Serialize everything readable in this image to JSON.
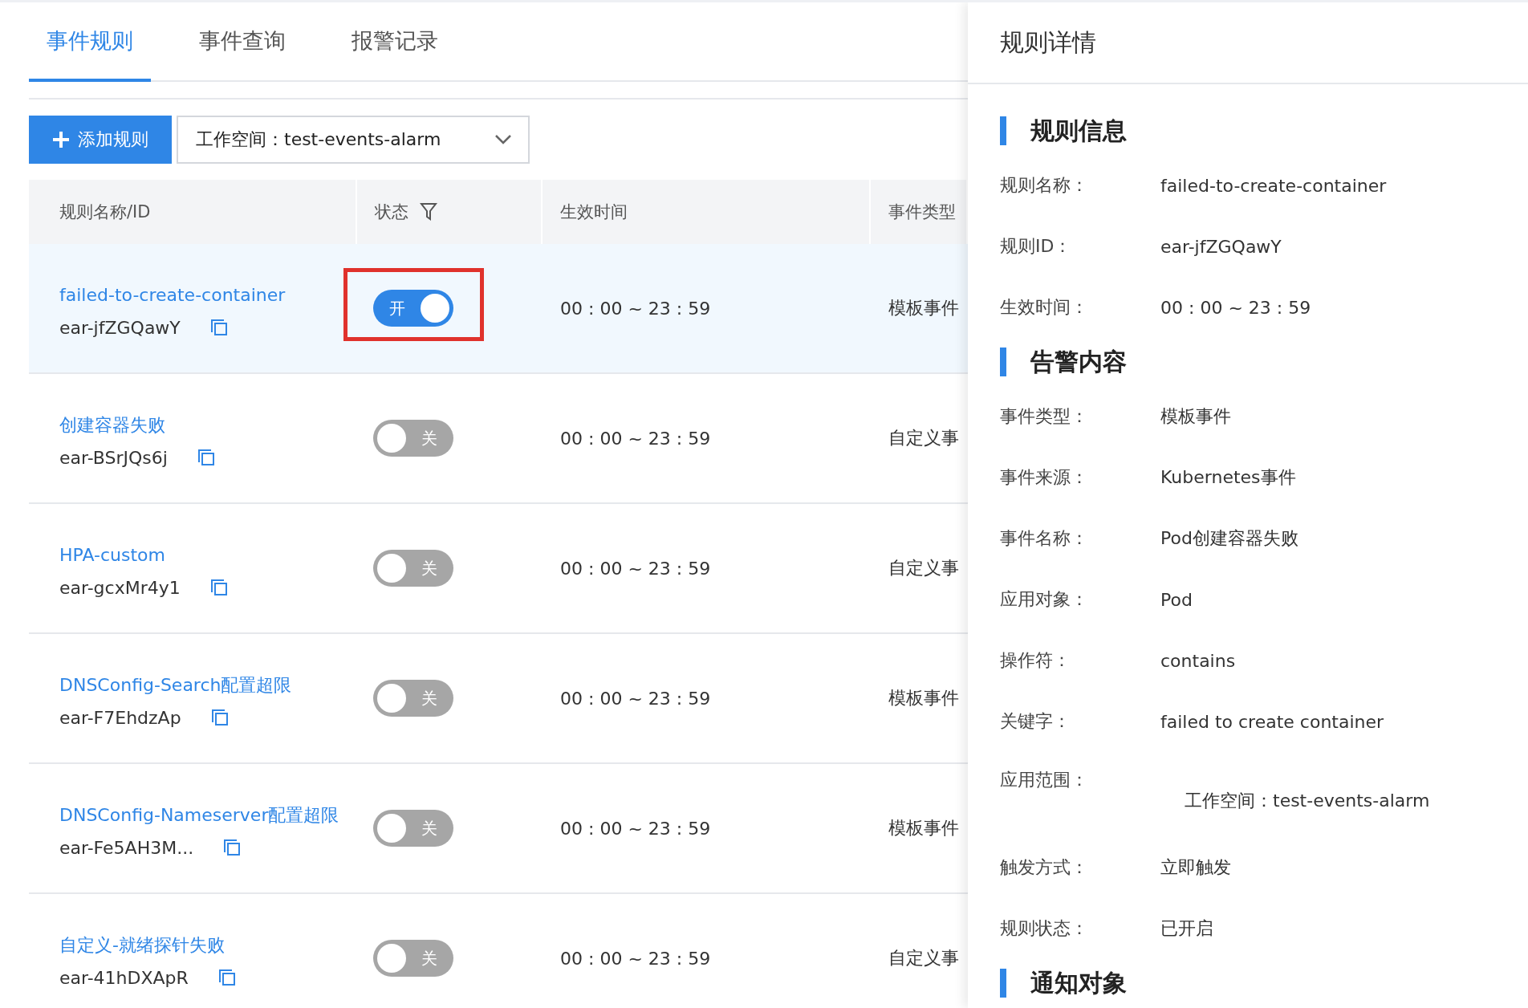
{
  "tabs": [
    {
      "label": "事件规则",
      "selected": true
    },
    {
      "label": "事件查询",
      "selected": false
    },
    {
      "label": "报警记录",
      "selected": false
    }
  ],
  "toolbar": {
    "add_button": "添加规则",
    "workspace_select": "工作空间：test-events-alarm"
  },
  "table": {
    "columns": [
      {
        "label": "规则名称/ID",
        "filter": false
      },
      {
        "label": "状态",
        "filter": true
      },
      {
        "label": "生效时间",
        "filter": false
      },
      {
        "label": "事件类型",
        "filter": false
      }
    ],
    "rows": [
      {
        "name": "failed-to-create-container",
        "id": "ear-jfZGQawY",
        "on": true,
        "switch_label": "开",
        "time": "00 : 00 ~ 23 : 59",
        "event_type": "模板事件",
        "selected": true,
        "highlighted": true
      },
      {
        "name": "创建容器失败",
        "id": "ear-BSrJQs6j",
        "on": false,
        "switch_label": "关",
        "time": "00 : 00 ~ 23 : 59",
        "event_type": "自定义事",
        "selected": false,
        "highlighted": false
      },
      {
        "name": "HPA-custom",
        "id": "ear-gcxMr4y1",
        "on": false,
        "switch_label": "关",
        "time": "00 : 00 ~ 23 : 59",
        "event_type": "自定义事",
        "selected": false,
        "highlighted": false
      },
      {
        "name": "DNSConfig-Search配置超限",
        "id": "ear-F7EhdzAp",
        "on": false,
        "switch_label": "关",
        "time": "00 : 00 ~ 23 : 59",
        "event_type": "模板事件",
        "selected": false,
        "highlighted": false
      },
      {
        "name": "DNSConfig-Nameserver配置超限",
        "id": "ear-Fe5AH3M...",
        "on": false,
        "switch_label": "关",
        "time": "00 : 00 ~ 23 : 59",
        "event_type": "模板事件",
        "selected": false,
        "highlighted": false
      },
      {
        "name": "自定义-就绪探针失败",
        "id": "ear-41hDXApR",
        "on": false,
        "switch_label": "关",
        "time": "00 : 00 ~ 23 : 59",
        "event_type": "自定义事",
        "selected": false,
        "highlighted": false
      }
    ]
  },
  "detail_panel": {
    "title": "规则详情",
    "sections": [
      {
        "title": "规则信息",
        "fields": [
          {
            "label": "规则名称：",
            "value": "failed-to-create-container",
            "kind": "inline"
          },
          {
            "label": "规则ID：",
            "value": "ear-jfZGQawY",
            "kind": "inline"
          },
          {
            "label": "生效时间：",
            "value": "00 : 00 ~ 23 : 59",
            "kind": "inline"
          }
        ]
      },
      {
        "title": "告警内容",
        "fields": [
          {
            "label": "事件类型：",
            "value": "模板事件",
            "kind": "inline"
          },
          {
            "label": "事件来源：",
            "value": "Kubernetes事件",
            "kind": "inline"
          },
          {
            "label": "事件名称：",
            "value": "Pod创建容器失败",
            "kind": "inline"
          },
          {
            "label": "应用对象：",
            "value": "Pod",
            "kind": "inline"
          },
          {
            "label": "操作符：",
            "value": "contains",
            "kind": "inline"
          },
          {
            "label": "关键字：",
            "value": "failed to create container",
            "kind": "inline"
          },
          {
            "label": "应用范围：",
            "value": "工作空间：test-events-alarm",
            "kind": "block"
          },
          {
            "label": "触发方式：",
            "value": "立即触发",
            "kind": "inline"
          },
          {
            "label": "规则状态：",
            "value": "已开启",
            "kind": "inline"
          }
        ]
      },
      {
        "title": "通知对象"
      }
    ]
  }
}
